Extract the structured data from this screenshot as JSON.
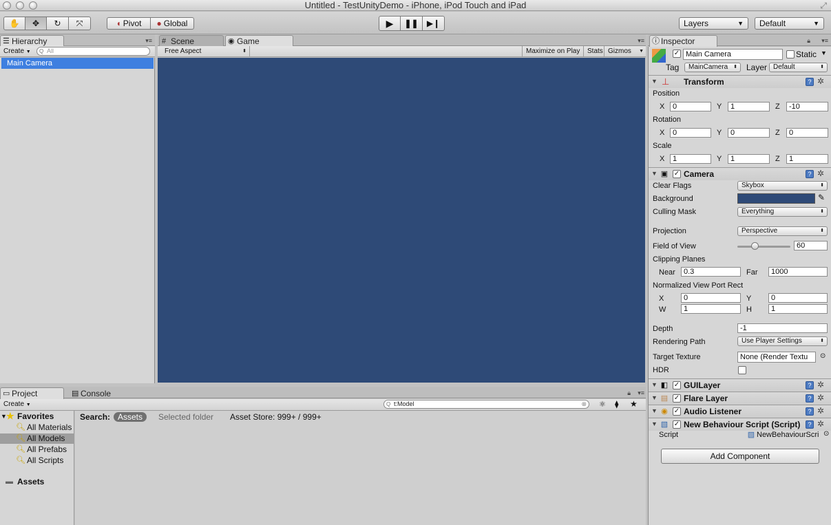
{
  "window": {
    "title": "Untitled - TestUnityDemo - iPhone, iPod Touch and iPad"
  },
  "toolbar": {
    "tools": [
      {
        "name": "hand-tool",
        "glyph": "✋"
      },
      {
        "name": "move-tool",
        "glyph": "✥"
      },
      {
        "name": "rotate-tool",
        "glyph": "↻"
      },
      {
        "name": "scale-tool",
        "glyph": "⤧"
      }
    ],
    "pivot_label": "Pivot",
    "global_label": "Global",
    "play_glyph": "▶",
    "pause_glyph": "❚❚",
    "step_glyph": "▶❙",
    "layers_label": "Layers",
    "layout_label": "Default"
  },
  "hierarchy": {
    "tab_label": "Hierarchy",
    "create_label": "Create",
    "search_placeholder": "All",
    "items": [
      "Main Camera"
    ]
  },
  "scene_tab": {
    "label": "Scene"
  },
  "game_tab": {
    "label": "Game",
    "aspect_label": "Free Aspect",
    "maximize_label": "Maximize on Play",
    "stats_label": "Stats",
    "gizmos_label": "Gizmos",
    "background_color": "#2e4a77"
  },
  "inspector": {
    "tab_label": "Inspector",
    "object_name": "Main Camera",
    "static_label": "Static",
    "tag_label": "Tag",
    "tag_value": "MainCamera",
    "layer_label": "Layer",
    "layer_value": "Default",
    "transform": {
      "title": "Transform",
      "position_label": "Position",
      "rotation_label": "Rotation",
      "scale_label": "Scale",
      "x_label": "X",
      "y_label": "Y",
      "z_label": "Z",
      "position": {
        "x": "0",
        "y": "1",
        "z": "-10"
      },
      "rotation": {
        "x": "0",
        "y": "0",
        "z": "0"
      },
      "scale": {
        "x": "1",
        "y": "1",
        "z": "1"
      }
    },
    "camera": {
      "title": "Camera",
      "clear_flags_label": "Clear Flags",
      "clear_flags_value": "Skybox",
      "background_label": "Background",
      "background_color": "#2e4a77",
      "culling_mask_label": "Culling Mask",
      "culling_mask_value": "Everything",
      "projection_label": "Projection",
      "projection_value": "Perspective",
      "fov_label": "Field of View",
      "fov_value": "60",
      "fov_fraction": 0.33,
      "clipping_label": "Clipping Planes",
      "near_label": "Near",
      "near_value": "0.3",
      "far_label": "Far",
      "far_value": "1000",
      "viewport_label": "Normalized View Port Rect",
      "vp_x_label": "X",
      "vp_x": "0",
      "vp_y_label": "Y",
      "vp_y": "0",
      "vp_w_label": "W",
      "vp_w": "1",
      "vp_h_label": "H",
      "vp_h": "1",
      "depth_label": "Depth",
      "depth_value": "-1",
      "rendering_path_label": "Rendering Path",
      "rendering_path_value": "Use Player Settings",
      "target_texture_label": "Target Texture",
      "target_texture_value": "None (Render Textu",
      "hdr_label": "HDR"
    },
    "components": [
      "GUILayer",
      "Flare Layer",
      "Audio Listener",
      "New Behaviour Script (Script)"
    ],
    "script_label": "Script",
    "script_value": "NewBehaviourScri",
    "add_component_label": "Add Component",
    "help_glyph": "?",
    "gear_glyph": "✲"
  },
  "project": {
    "tab_label": "Project",
    "console_tab_label": "Console",
    "create_label": "Create",
    "search_value": "t:Model",
    "favorites_label": "Favorites",
    "favorites": [
      "All Materials",
      "All Models",
      "All Prefabs",
      "All Scripts"
    ],
    "assets_label": "Assets",
    "search_label": "Search:",
    "search_scope_assets": "Assets",
    "search_scope_selected": "Selected folder",
    "asset_store_label": "Asset Store: 999+ / 999+"
  }
}
